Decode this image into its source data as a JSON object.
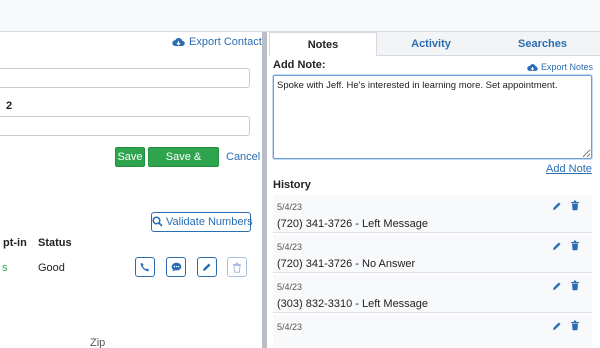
{
  "left_panel": {
    "export_contact_label": "Export Contact",
    "field_2_label": "2",
    "save_label": "Save",
    "save_return_label": "Save & Return",
    "cancel_label": "Cancel",
    "validate_label": "Validate Numbers",
    "columns": {
      "optin": "pt-in",
      "status": "Status"
    },
    "row": {
      "optin": "s",
      "status": "Good"
    },
    "zip_label": "Zip"
  },
  "right_panel": {
    "tabs": [
      {
        "label": "Notes",
        "active": true
      },
      {
        "label": "Activity",
        "active": false
      },
      {
        "label": "Searches",
        "active": false
      }
    ],
    "add_note_label": "Add Note:",
    "export_notes_label": "Export Notes",
    "note_text": "Spoke with Jeff. He's interested in learning more. Set appointment.",
    "add_note_link": "Add Note",
    "history_label": "History",
    "history": [
      {
        "date": "5/4/23",
        "text": "(720) 341-3726 - Left Message"
      },
      {
        "date": "5/4/23",
        "text": "(720) 341-3726 - No Answer"
      },
      {
        "date": "5/4/23",
        "text": "(303) 832-3310 - Left Message"
      },
      {
        "date": "5/4/23",
        "text": ""
      }
    ]
  },
  "colors": {
    "accent": "#2a6db3",
    "success": "#2ea44f",
    "divider": "#b9bec4"
  },
  "icons": {
    "export": "cloud-download-icon",
    "validate": "search-icon",
    "phone": "phone-icon",
    "sms": "chat-icon",
    "edit": "pencil-icon",
    "delete": "trash-icon"
  }
}
